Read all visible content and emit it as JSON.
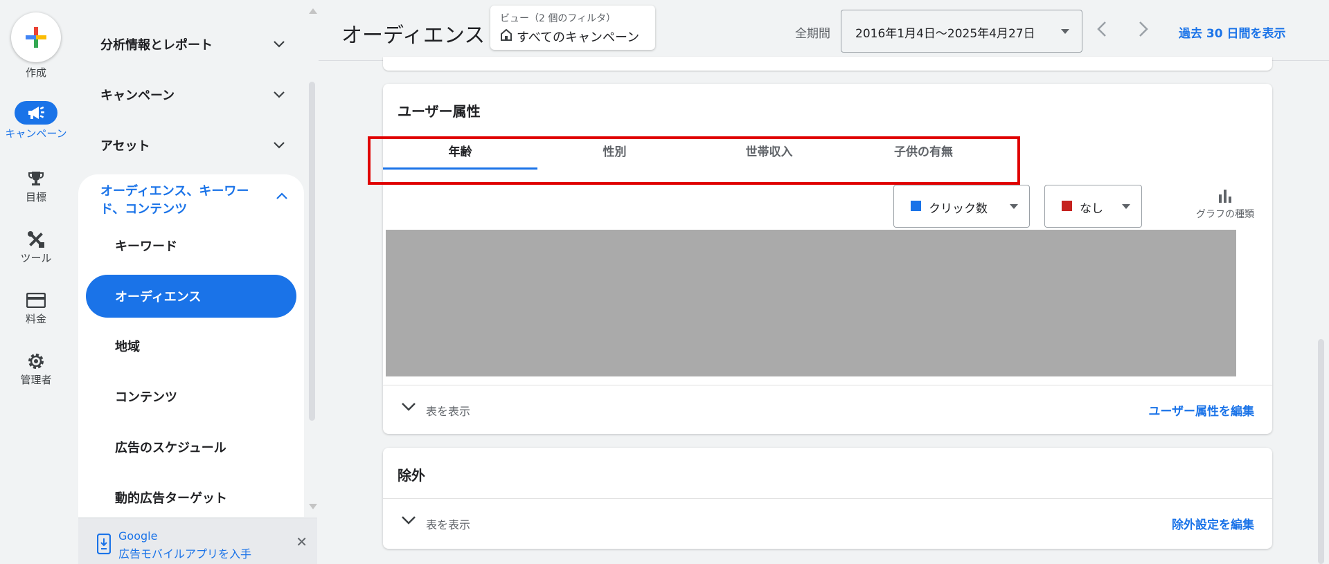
{
  "rail": {
    "create_label": "作成",
    "items": [
      {
        "label": "キャンペーン",
        "icon": "megaphone-icon",
        "active": true
      },
      {
        "label": "目標",
        "icon": "trophy-icon"
      },
      {
        "label": "ツール",
        "icon": "tools-icon"
      },
      {
        "label": "料金",
        "icon": "credit-card-icon"
      },
      {
        "label": "管理者",
        "icon": "gear-icon"
      }
    ]
  },
  "nav": {
    "sections": [
      {
        "label": "分析情報とレポート"
      },
      {
        "label": "キャンペーン"
      },
      {
        "label": "アセット"
      }
    ],
    "open_section": {
      "label": "オーディエンス、キーワード、コンテンツ",
      "items": [
        {
          "label": "キーワード"
        },
        {
          "label": "オーディエンス",
          "active": true
        },
        {
          "label": "地域"
        },
        {
          "label": "コンテンツ"
        },
        {
          "label": "広告のスケジュール"
        },
        {
          "label": "動的広告ターゲット"
        }
      ]
    },
    "app_banner": {
      "line1": "Google",
      "line2": "広告モバイルアプリを入手"
    }
  },
  "header": {
    "title": "オーディエンス",
    "view_filter_label": "ビュー（2 個のフィルタ）",
    "view_value": "すべてのキャンペーン",
    "period_label": "全期間",
    "date_range": "2016年1月4日～2025年4月27日",
    "last30_link": "過去 30 日間を表示"
  },
  "demographics": {
    "title": "ユーザー属性",
    "tabs": [
      {
        "label": "年齢",
        "active": true
      },
      {
        "label": "性別"
      },
      {
        "label": "世帯収入"
      },
      {
        "label": "子供の有無"
      }
    ],
    "metric1": {
      "label": "クリック数",
      "color": "#1a73e8"
    },
    "metric2": {
      "label": "なし",
      "color": "#c5221f"
    },
    "chart_type_label": "グラフの種類",
    "show_table": "表を表示",
    "edit_link": "ユーザー属性を編集"
  },
  "exclusions": {
    "title": "除外",
    "show_table": "表を表示",
    "edit_link": "除外設定を編集"
  },
  "colors": {
    "accent": "#1a73e8",
    "highlight": "#e00000"
  }
}
